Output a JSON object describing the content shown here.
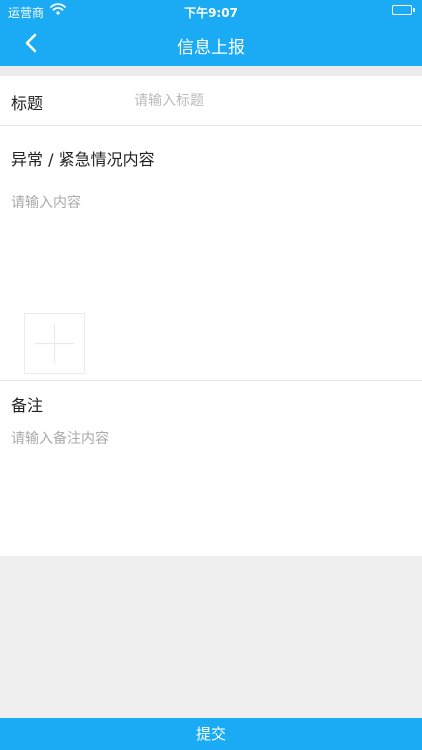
{
  "status_bar": {
    "carrier": "运营商",
    "time": "下午9:07",
    "icons": [
      "wifi-icon",
      "battery-icon"
    ]
  },
  "nav": {
    "title": "信息上报",
    "back_icon": "chevron-left-icon"
  },
  "form": {
    "title_label": "标题",
    "title_placeholder": "请输入标题",
    "content_label": "异常 / 紧急情况内容",
    "content_placeholder": "请输入内容",
    "add_image_icon": "plus-icon",
    "remark_label": "备注",
    "remark_placeholder": "请输入备注内容"
  },
  "submit_label": "提交",
  "colors": {
    "accent": "#1aabf4",
    "background": "#efefef"
  }
}
